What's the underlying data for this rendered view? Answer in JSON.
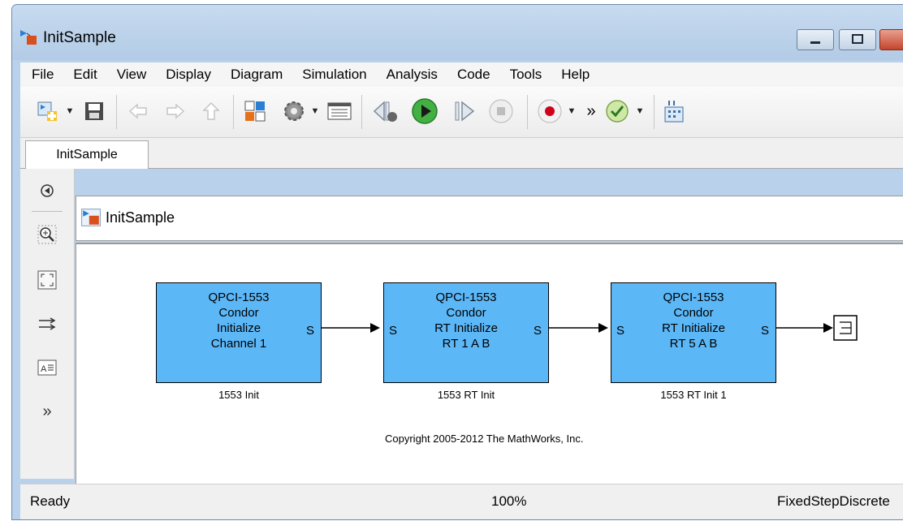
{
  "window": {
    "title": "InitSample"
  },
  "menu": {
    "items": [
      "File",
      "Edit",
      "View",
      "Display",
      "Diagram",
      "Simulation",
      "Analysis",
      "Code",
      "Tools",
      "Help"
    ]
  },
  "toolbar": {
    "icons": [
      "new-model-icon",
      "save-icon",
      "back-arrow-icon",
      "forward-arrow-icon",
      "up-arrow-icon",
      "library-browser-icon",
      "settings-gear-icon",
      "model-explorer-icon",
      "step-back-icon",
      "run-icon",
      "step-forward-icon",
      "stop-icon",
      "record-icon",
      "more-icon",
      "check-model-icon",
      "build-icon"
    ],
    "overflow_label": "»"
  },
  "tabs": [
    {
      "label": "InitSample"
    }
  ],
  "address": {
    "path": "InitSample"
  },
  "palette": {
    "icons": [
      "hide-show-browser-icon",
      "zoom-icon",
      "fit-to-view-icon",
      "signal-routing-icon",
      "annotation-icon",
      "expand-more-icon"
    ]
  },
  "diagram": {
    "blocks": [
      {
        "lines": [
          "QPCI-1553",
          "Condor",
          "Initialize",
          "Channel 1"
        ],
        "name": "1553 Init",
        "in_port": "",
        "out_port": "S"
      },
      {
        "lines": [
          "QPCI-1553",
          "Condor",
          "RT Initialize",
          "RT 1 A B"
        ],
        "name": "1553 RT Init",
        "in_port": "S",
        "out_port": "S"
      },
      {
        "lines": [
          "QPCI-1553",
          "Condor",
          "RT Initialize",
          "RT 5 A B"
        ],
        "name": "1553 RT Init 1",
        "in_port": "S",
        "out_port": "S"
      }
    ],
    "copyright": "Copyright 2005-2012 The MathWorks, Inc."
  },
  "status": {
    "state": "Ready",
    "zoom": "100%",
    "solver": "FixedStepDiscrete"
  },
  "colors": {
    "block_fill": "#5cb7f7",
    "run_green": "#2f9e2f",
    "record_red": "#d0021b"
  }
}
